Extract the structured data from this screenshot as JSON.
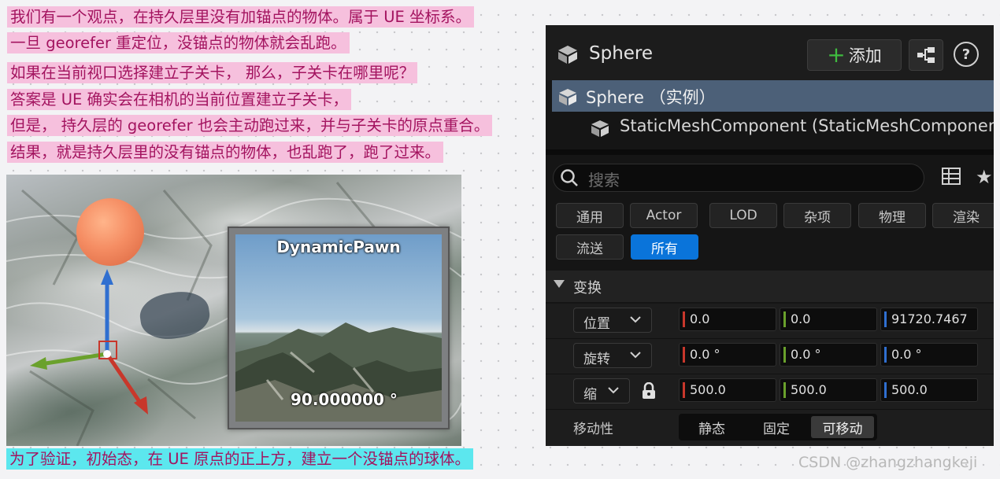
{
  "notes": [
    "我们有一个观点，在持久层里没有加锚点的物体。属于 UE 坐标系。",
    "一旦 georefer 重定位，没锚点的物体就会乱跑。",
    "如果在当前视口选择建立子关卡， 那么，子关卡在哪里呢？",
    "答案是 UE 确实会在相机的当前位置建立子关卡，",
    "但是， 持久层的 georefer 也会主动跑过来，并与子关卡的原点重合。",
    "结果，就是持久层里的没有锚点的物体，也乱跑了，跑了过来。"
  ],
  "caption": "为了验证，初始态，在 UE 原点的正上方，建立一个没锚点的球体。",
  "viewport": {
    "preview_title": "DynamicPawn",
    "preview_angle": "90.000000 °"
  },
  "details_panel": {
    "title": "Sphere",
    "add_button": "添加",
    "selected_item": "Sphere （实例）",
    "component_item": "StaticMeshComponent (StaticMeshComponent0)",
    "search_placeholder": "搜索",
    "filter_tabs": [
      "通用",
      "Actor",
      "LOD",
      "杂项",
      "物理",
      "渲染",
      "流送",
      "所有"
    ],
    "active_tab": "所有",
    "section_title": "变换",
    "transform": {
      "location": {
        "label": "位置",
        "x": "0.0",
        "y": "0.0",
        "z": "91720.7467"
      },
      "rotation": {
        "label": "旋转",
        "x": "0.0 °",
        "y": "0.0 °",
        "z": "0.0 °"
      },
      "scale": {
        "label": "缩",
        "x": "500.0",
        "y": "500.0",
        "z": "500.0"
      }
    },
    "mobility": {
      "label": "移动性",
      "options": [
        "静态",
        "固定",
        "可移动"
      ],
      "selected": "可移动"
    }
  },
  "axis_colors": {
    "x": "#c8372b",
    "y": "#6aa12c",
    "z": "#2f6fd0"
  },
  "watermark": "CSDN @zhangzhangkeji"
}
